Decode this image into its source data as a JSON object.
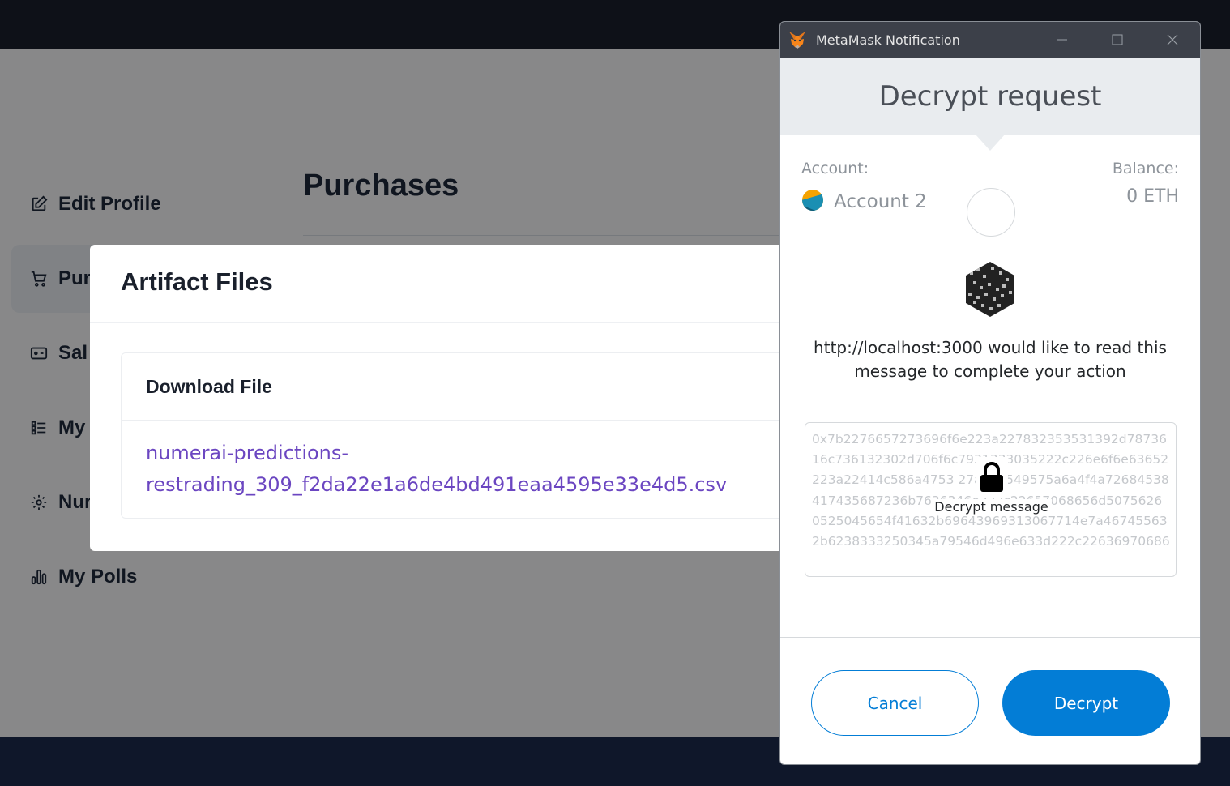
{
  "app": {
    "sidebar": {
      "items": [
        {
          "label": "Edit Profile",
          "icon": "edit-icon",
          "active": false
        },
        {
          "label": "Pur",
          "icon": "cart-icon",
          "active": true
        },
        {
          "label": "Sal",
          "icon": "wallet-icon",
          "active": false
        },
        {
          "label": "My",
          "icon": "list-icon",
          "active": false
        },
        {
          "label": "Nur",
          "icon": "gear-icon",
          "active": false
        },
        {
          "label": "My Polls",
          "icon": "bar-chart-icon",
          "active": false
        }
      ]
    },
    "page_title": "Purchases"
  },
  "modal": {
    "title": "Artifact Files",
    "column_header": "Download File",
    "file_link": "numerai-predictions-restrading_309_f2da22e1a6de4bd491eaa4595e33e4d5.csv"
  },
  "metamask": {
    "window_title": "MetaMask Notification",
    "heading": "Decrypt request",
    "account_label": "Account:",
    "account_name": "Account 2",
    "balance_label": "Balance:",
    "balance_value": "0 ETH",
    "request_text": "http://localhost:3000 would like to read this message to complete your action",
    "ciphertext": "0x7b2276657273696f6e223a227832353531392d7873616c736132302d706f6c7931333035222c226e6f6e63652223a22414c586a4753 27a473549575a6a4f4a72684538417435687236b7636346e222c22657068656d5075626 0525045654f41632b69643969313067714e7a467455632b6238333250345a79546d496e633d222c22636970686",
    "decrypt_message_label": "Decrypt message",
    "cancel_label": "Cancel",
    "decrypt_label": "Decrypt",
    "colors": {
      "primary": "#037dd6",
      "header_bg": "#e9ecef"
    }
  }
}
